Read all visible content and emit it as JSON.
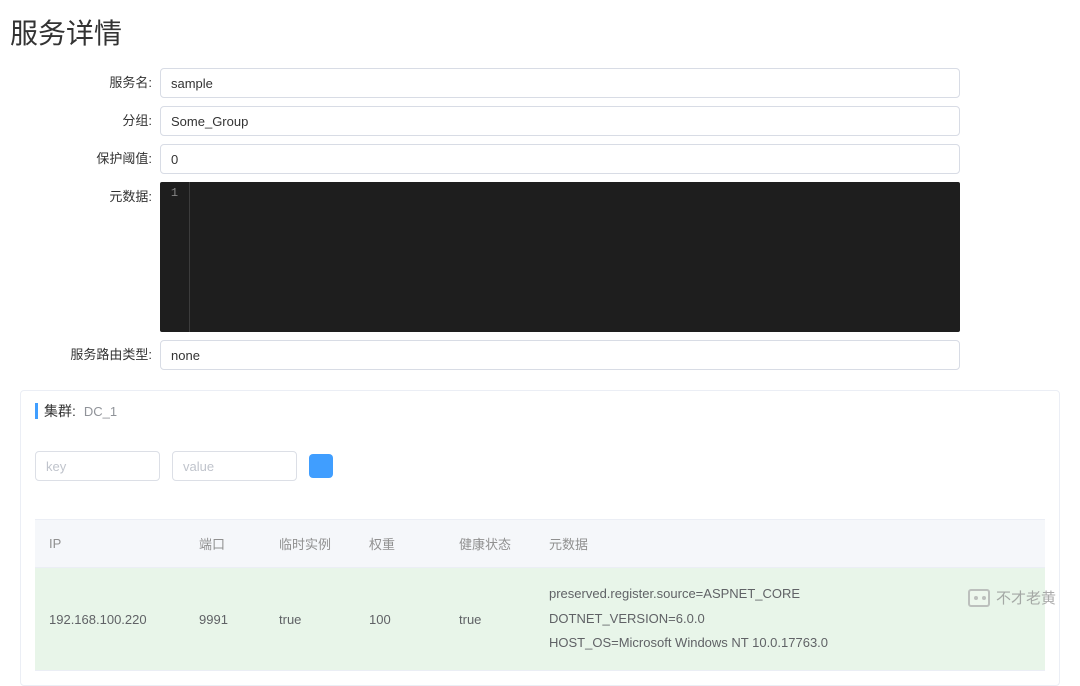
{
  "page": {
    "title": "服务详情"
  },
  "form": {
    "service_name": {
      "label": "服务名:",
      "value": "sample"
    },
    "group": {
      "label": "分组:",
      "value": "Some_Group"
    },
    "threshold": {
      "label": "保护阈值:",
      "value": "0"
    },
    "metadata": {
      "label": "元数据:",
      "gutter_line": "1"
    },
    "route_type": {
      "label": "服务路由类型:",
      "value": "none"
    }
  },
  "cluster": {
    "label": "集群:",
    "name": "DC_1",
    "filter": {
      "key_placeholder": "key",
      "value_placeholder": "value"
    },
    "columns": {
      "ip": "IP",
      "port": "端口",
      "ephemeral": "临时实例",
      "weight": "权重",
      "health": "健康状态",
      "metadata": "元数据"
    },
    "row": {
      "ip": "192.168.100.220",
      "port": "9991",
      "ephemeral": "true",
      "weight": "100",
      "health": "true",
      "metadata_lines": {
        "l1": "preserved.register.source=ASPNET_CORE",
        "l2": "DOTNET_VERSION=6.0.0",
        "l3": "HOST_OS=Microsoft Windows NT 10.0.17763.0"
      }
    }
  },
  "watermark": {
    "text": "不才老黄"
  }
}
